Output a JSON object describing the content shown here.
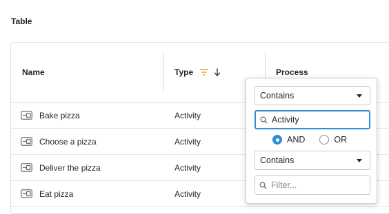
{
  "section": {
    "title": "Table"
  },
  "table": {
    "columns": [
      {
        "label": "Name"
      },
      {
        "label": "Type",
        "filter_icon": "filter-lines-icon",
        "sort_icon": "arrow-down-icon"
      },
      {
        "label": "Process"
      }
    ],
    "rows": [
      {
        "icon": "activity-icon",
        "name": "Bake pizza",
        "type": "Activity"
      },
      {
        "icon": "activity-icon",
        "name": "Choose a pizza",
        "type": "Activity"
      },
      {
        "icon": "activity-icon",
        "name": "Deliver the pizza",
        "type": "Activity"
      },
      {
        "icon": "activity-icon",
        "name": "Eat pizza",
        "type": "Activity"
      }
    ]
  },
  "filter_popover": {
    "condition1": {
      "value": "Contains"
    },
    "search1": {
      "value": "Activity",
      "placeholder": ""
    },
    "logic": {
      "options": [
        "AND",
        "OR"
      ],
      "selected": "AND"
    },
    "condition2": {
      "value": "Contains"
    },
    "search2": {
      "value": "",
      "placeholder": "Filter..."
    }
  },
  "colors": {
    "accent": "#2d8fd5",
    "filter_icon": "#e8a13a",
    "border": "#dcdfe4"
  }
}
